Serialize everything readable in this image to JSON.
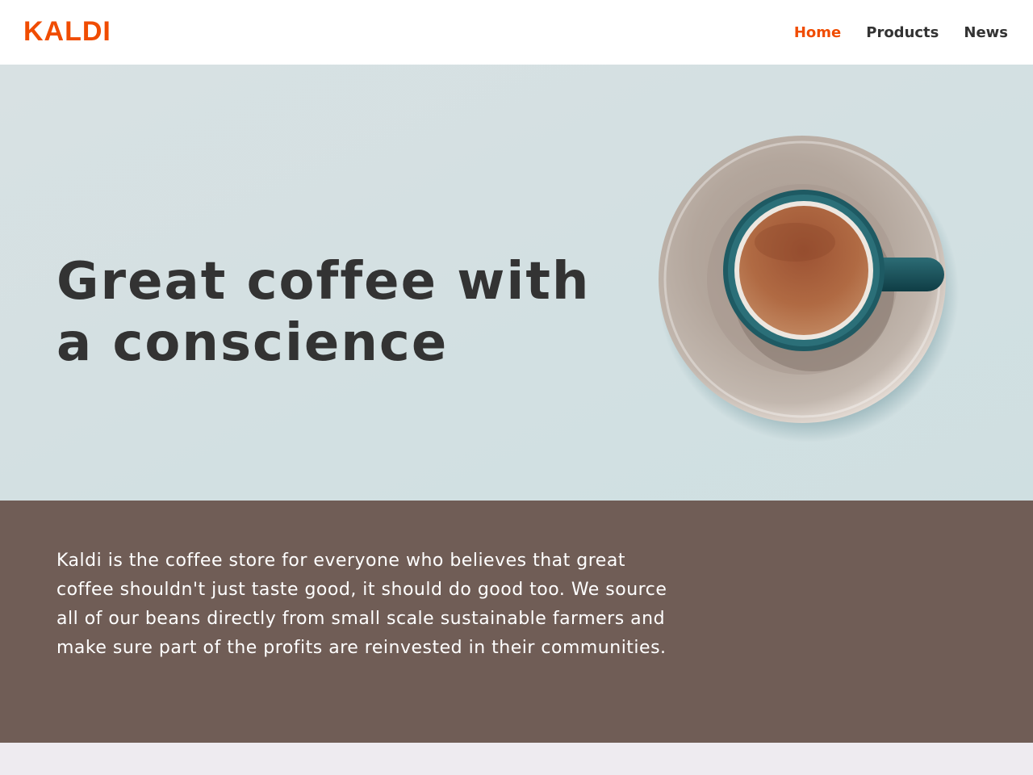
{
  "header": {
    "logo": "KALDI",
    "nav": [
      {
        "label": "Home",
        "active": true
      },
      {
        "label": "Products",
        "active": false
      },
      {
        "label": "News",
        "active": false
      }
    ]
  },
  "hero": {
    "title": "Great coffee with a conscience",
    "image": "coffee-cup-on-saucer"
  },
  "intro": {
    "text": "Kaldi is the coffee store for everyone who believes that great coffee shouldn't just taste good, it should do good too. We source all of our beans directly from small scale sustainable farmers and make sure part of the profits are reinvested in their communities."
  },
  "colors": {
    "brand": "#f04c00",
    "nav_text": "#333333",
    "hero_bg": "#d4e0e1",
    "intro_bg": "#705d56",
    "footer_bg": "#eeebf0",
    "title_text": "#333333"
  }
}
